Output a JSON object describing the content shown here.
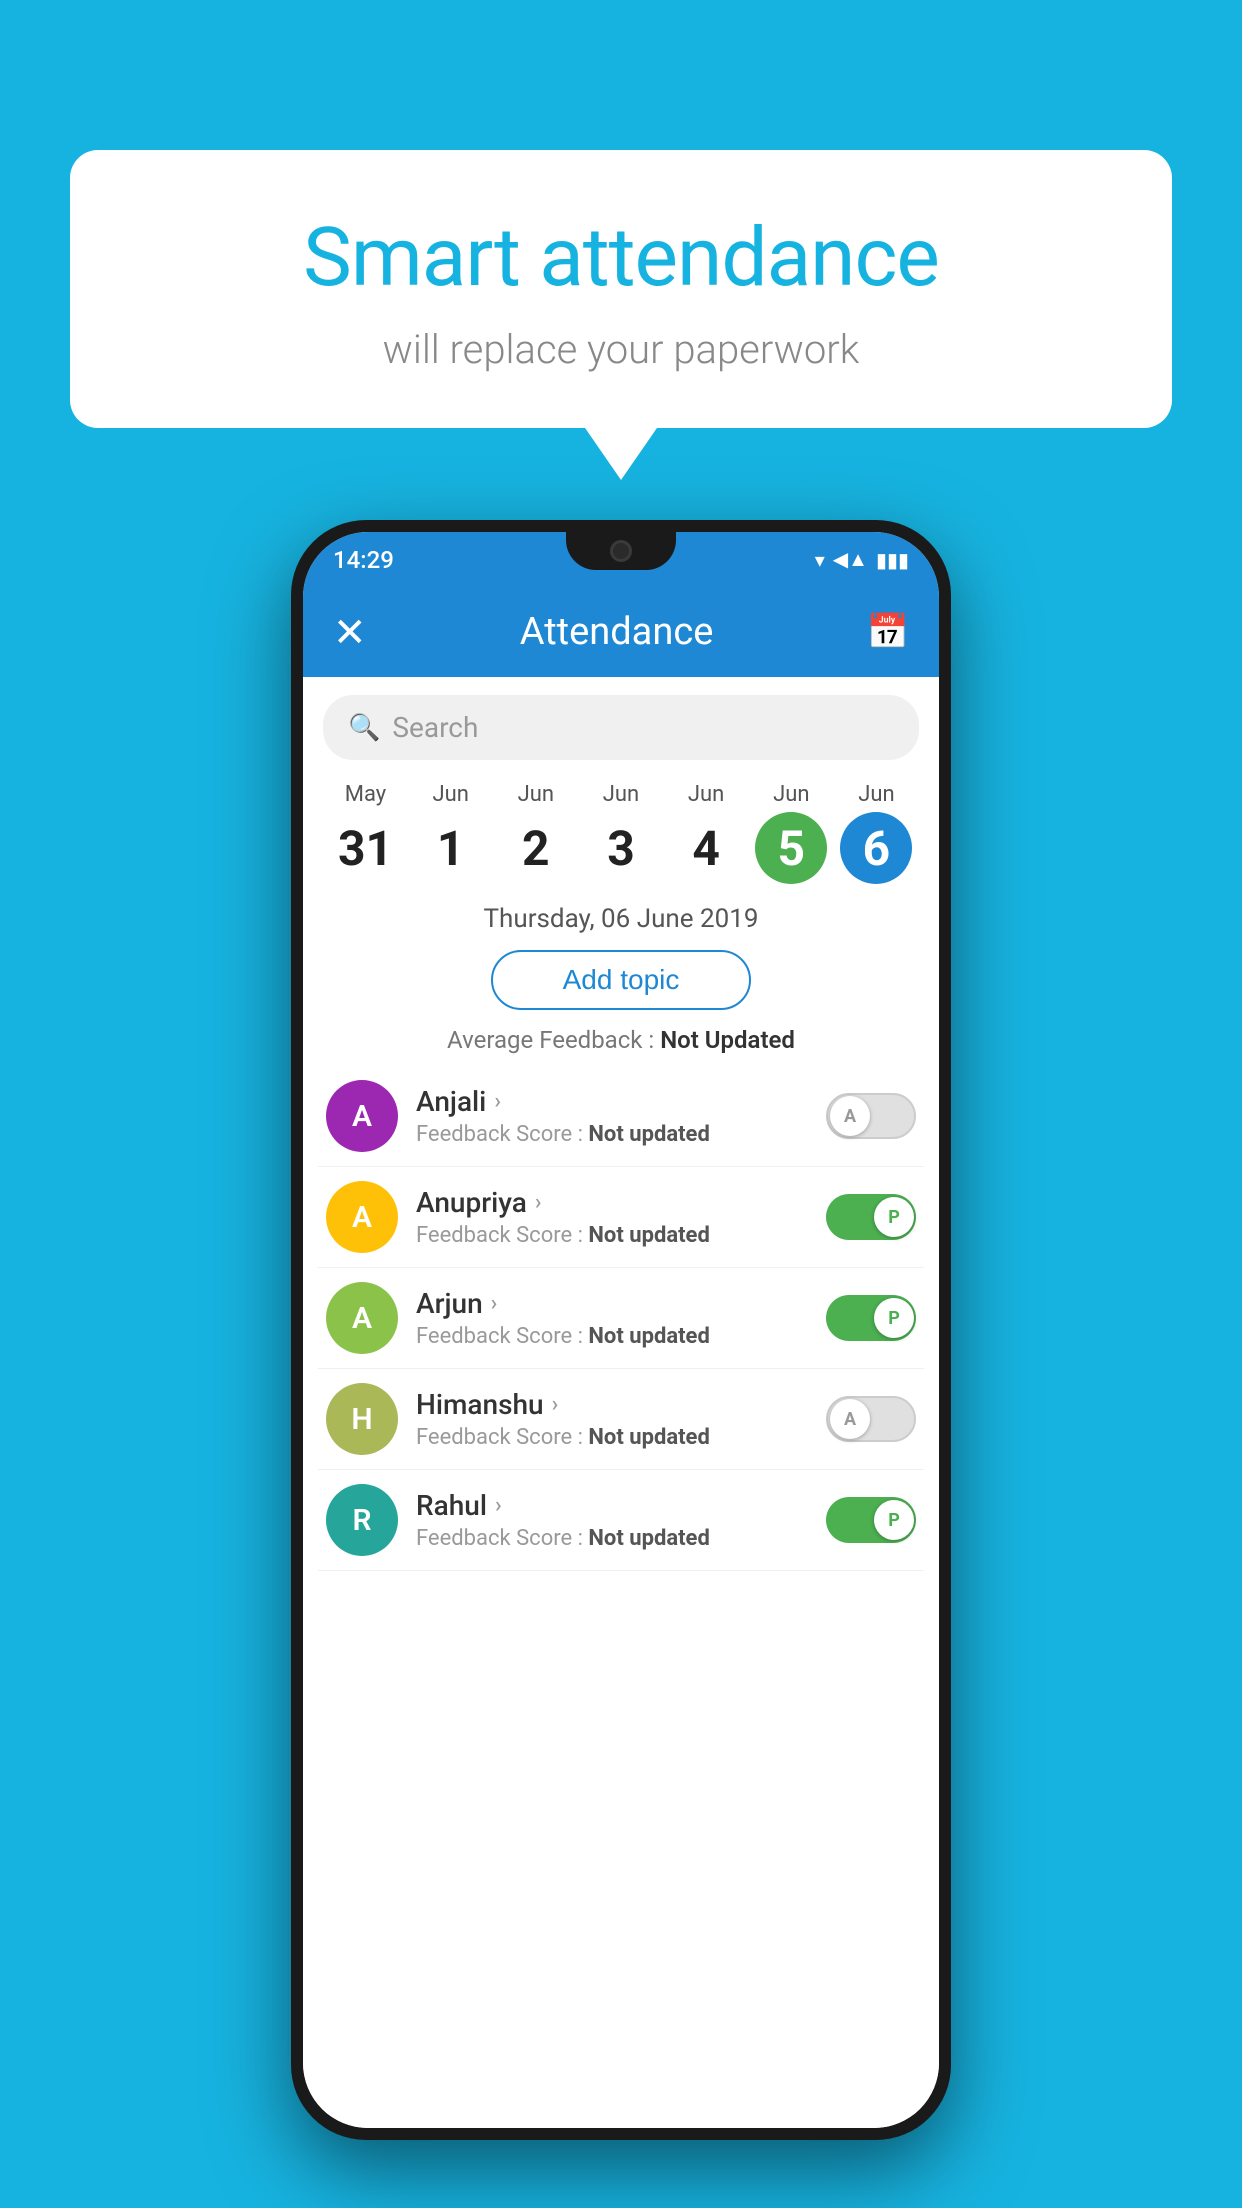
{
  "background_color": "#17b3e0",
  "speech_bubble": {
    "title": "Smart attendance",
    "subtitle": "will replace your paperwork"
  },
  "status_bar": {
    "time": "14:29",
    "wifi_icon": "▾",
    "signal_icon": "▲",
    "battery_icon": "▮"
  },
  "app_bar": {
    "title": "Attendance",
    "close_label": "✕",
    "calendar_label": "📅"
  },
  "search": {
    "placeholder": "Search"
  },
  "date_scroller": {
    "dates": [
      {
        "month": "May",
        "day": "31",
        "state": "normal"
      },
      {
        "month": "Jun",
        "day": "1",
        "state": "normal"
      },
      {
        "month": "Jun",
        "day": "2",
        "state": "normal"
      },
      {
        "month": "Jun",
        "day": "3",
        "state": "normal"
      },
      {
        "month": "Jun",
        "day": "4",
        "state": "normal"
      },
      {
        "month": "Jun",
        "day": "5",
        "state": "today"
      },
      {
        "month": "Jun",
        "day": "6",
        "state": "selected"
      }
    ]
  },
  "selected_date_label": "Thursday, 06 June 2019",
  "add_topic_label": "Add topic",
  "avg_feedback_prefix": "Average Feedback : ",
  "avg_feedback_value": "Not Updated",
  "students": [
    {
      "name": "Anjali",
      "avatar_letter": "A",
      "avatar_color": "#9c27b0",
      "score_label": "Feedback Score : ",
      "score_value": "Not updated",
      "toggle_state": "off",
      "toggle_label": "A"
    },
    {
      "name": "Anupriya",
      "avatar_letter": "A",
      "avatar_color": "#ffc107",
      "score_label": "Feedback Score : ",
      "score_value": "Not updated",
      "toggle_state": "on",
      "toggle_label": "P"
    },
    {
      "name": "Arjun",
      "avatar_letter": "A",
      "avatar_color": "#8bc34a",
      "score_label": "Feedback Score : ",
      "score_value": "Not updated",
      "toggle_state": "on",
      "toggle_label": "P"
    },
    {
      "name": "Himanshu",
      "avatar_letter": "H",
      "avatar_color": "#aab857",
      "score_label": "Feedback Score : ",
      "score_value": "Not updated",
      "toggle_state": "off",
      "toggle_label": "A"
    },
    {
      "name": "Rahul",
      "avatar_letter": "R",
      "avatar_color": "#26a69a",
      "score_label": "Feedback Score : ",
      "score_value": "Not updated",
      "toggle_state": "on",
      "toggle_label": "P"
    }
  ]
}
